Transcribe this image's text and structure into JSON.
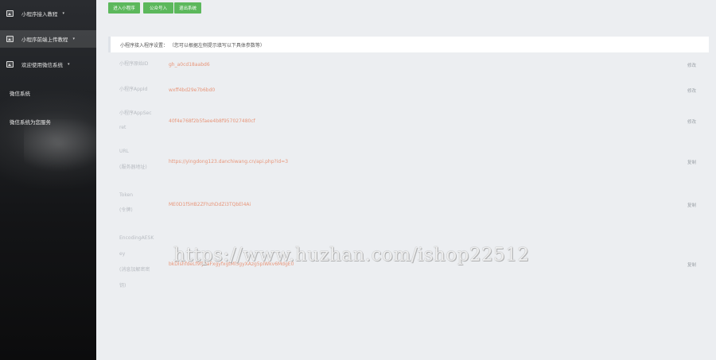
{
  "sidebar": {
    "menu": [
      {
        "label": "小程序接入教程",
        "has_caret": true
      },
      {
        "label": "小程序前端上传教程",
        "has_caret": true
      },
      {
        "label": "欢迎使用微信系统",
        "has_caret": true
      }
    ],
    "links": [
      "微信系统",
      "微信系统为您服务"
    ],
    "caret_glyph": "▾"
  },
  "toolbar": {
    "buttons": [
      "进入小程序",
      "公众号入",
      "退出系统"
    ],
    "color": "#5cb85c"
  },
  "panel": {
    "title": "小程序接入程序设置： （您可以根据左侧提示填写以下具体参数等）"
  },
  "fields": [
    {
      "label": "小程序原始ID",
      "value": "gh_a0cd18aabd6",
      "action": "修改"
    },
    {
      "label": "小程序AppId",
      "value": "wxff4bd29e7b6bd0",
      "action": "修改"
    },
    {
      "label_lines": [
        "小程序AppSec",
        "ret"
      ],
      "value": "40f4e768f2b5faee4b8f957027480cf",
      "action": "修改"
    },
    {
      "label_lines": [
        "URL",
        "(服务器地址)"
      ],
      "value": "https://yingdong123.danchiwang.cn/api.php?id=3",
      "action": "复制"
    },
    {
      "label_lines": [
        "Token",
        "(令牌)"
      ],
      "value": "ME0D1f5HB2ZFhzhDdZi3TQbEl4Ai",
      "action": "复制"
    },
    {
      "label_lines": [
        "EncodingAESK",
        "ey",
        "(消息加解密密",
        "钥)"
      ],
      "value": "bkDlshfdeLf9fjDaFxgyfxgtMl5gyXAzg5pIWkv6MdgE0",
      "action": "复制"
    }
  ],
  "watermark": "https://www.huzhan.com/ishop22512"
}
